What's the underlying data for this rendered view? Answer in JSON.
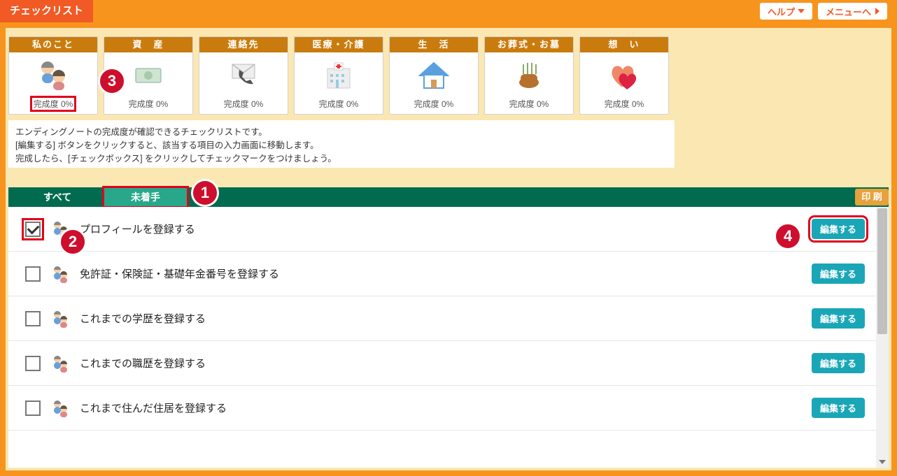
{
  "header": {
    "title": "チェックリスト",
    "help_label": "ヘルプ",
    "menu_label": "メニューへ"
  },
  "categories": [
    {
      "title": "私のこと",
      "progress": "完成度 0%",
      "icon": "people"
    },
    {
      "title": "資　産",
      "progress": "完成度 0%",
      "icon": "money"
    },
    {
      "title": "連絡先",
      "progress": "完成度 0%",
      "icon": "contact"
    },
    {
      "title": "医療・介護",
      "progress": "完成度 0%",
      "icon": "medical"
    },
    {
      "title": "生　活",
      "progress": "完成度 0%",
      "icon": "house"
    },
    {
      "title": "お葬式・お墓",
      "progress": "完成度 0%",
      "icon": "funeral"
    },
    {
      "title": "想　い",
      "progress": "完成度 0%",
      "icon": "heart"
    }
  ],
  "description": {
    "line1": "エンディングノートの完成度が確認できるチェックリストです。",
    "line2": "[編集する] ボタンをクリックすると、該当する項目の入力画面に移動します。",
    "line3": "完成したら、[チェックボックス] をクリックしてチェックマークをつけましょう。"
  },
  "tabs": {
    "all": "すべて",
    "pending": "未着手",
    "print": "印 刷"
  },
  "list": [
    {
      "text": "プロフィールを登録する",
      "checked": true,
      "edit": "編集する",
      "hl_chk": true,
      "hl_edit": true
    },
    {
      "text": "免許証・保険証・基礎年金番号を登録する",
      "checked": false,
      "edit": "編集する"
    },
    {
      "text": "これまでの学歴を登録する",
      "checked": false,
      "edit": "編集する"
    },
    {
      "text": "これまでの職歴を登録する",
      "checked": false,
      "edit": "編集する"
    },
    {
      "text": "これまで住んだ住居を登録する",
      "checked": false,
      "edit": "編集する"
    }
  ],
  "annotations": [
    "1",
    "2",
    "3",
    "4"
  ]
}
